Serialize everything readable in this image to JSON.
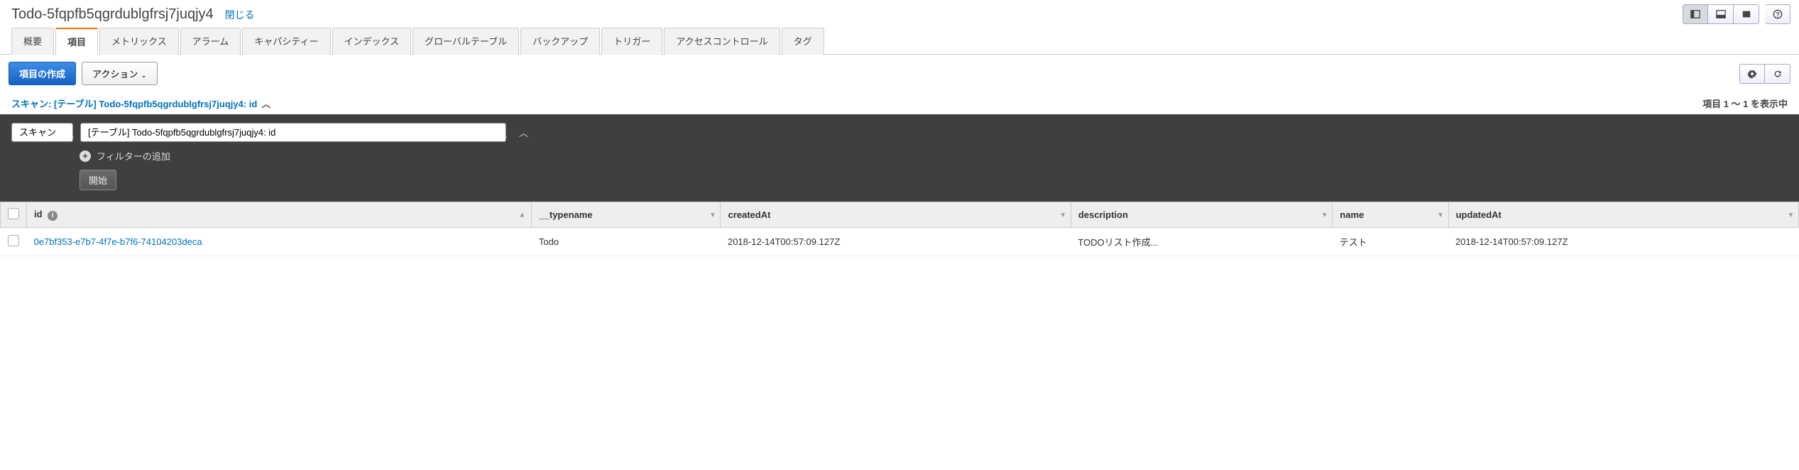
{
  "header": {
    "title": "Todo-5fqpfb5qgrdublgfrsj7juqjy4",
    "close": "閉じる"
  },
  "tabs": [
    {
      "id": "overview",
      "label": "概要"
    },
    {
      "id": "items",
      "label": "項目"
    },
    {
      "id": "metrics",
      "label": "メトリックス"
    },
    {
      "id": "alarms",
      "label": "アラーム"
    },
    {
      "id": "capacity",
      "label": "キャパシティー"
    },
    {
      "id": "indexes",
      "label": "インデックス"
    },
    {
      "id": "global",
      "label": "グローバルテーブル"
    },
    {
      "id": "backup",
      "label": "バックアップ"
    },
    {
      "id": "trigger",
      "label": "トリガー"
    },
    {
      "id": "access",
      "label": "アクセスコントロール"
    },
    {
      "id": "tags",
      "label": "タグ"
    }
  ],
  "active_tab": "items",
  "toolbar": {
    "create_item": "項目の作成",
    "actions": "アクション"
  },
  "scan": {
    "heading": "スキャン: [テーブル] Todo-5fqpfb5qgrdublgfrsj7juqjy4: id",
    "items_count_text": "項目 1 ～ 1 を表示中",
    "mode": "スキャン",
    "target": "[テーブル] Todo-5fqpfb5qgrdublgfrsj7juqjy4: id",
    "add_filter": "フィルターの追加",
    "start": "開始"
  },
  "columns": [
    {
      "key": "id",
      "label": "id",
      "info": true,
      "sort": "asc"
    },
    {
      "key": "__typename",
      "label": "__typename",
      "info": false
    },
    {
      "key": "createdAt",
      "label": "createdAt",
      "info": false
    },
    {
      "key": "description",
      "label": "description",
      "info": false
    },
    {
      "key": "name",
      "label": "name",
      "info": false
    },
    {
      "key": "updatedAt",
      "label": "updatedAt",
      "info": false
    }
  ],
  "rows": [
    {
      "id": "0e7bf353-e7b7-4f7e-b7f6-74104203deca",
      "__typename": "Todo",
      "createdAt": "2018-12-14T00:57:09.127Z",
      "description": "TODOリスト作成...",
      "name": "テスト",
      "updatedAt": "2018-12-14T00:57:09.127Z"
    }
  ]
}
